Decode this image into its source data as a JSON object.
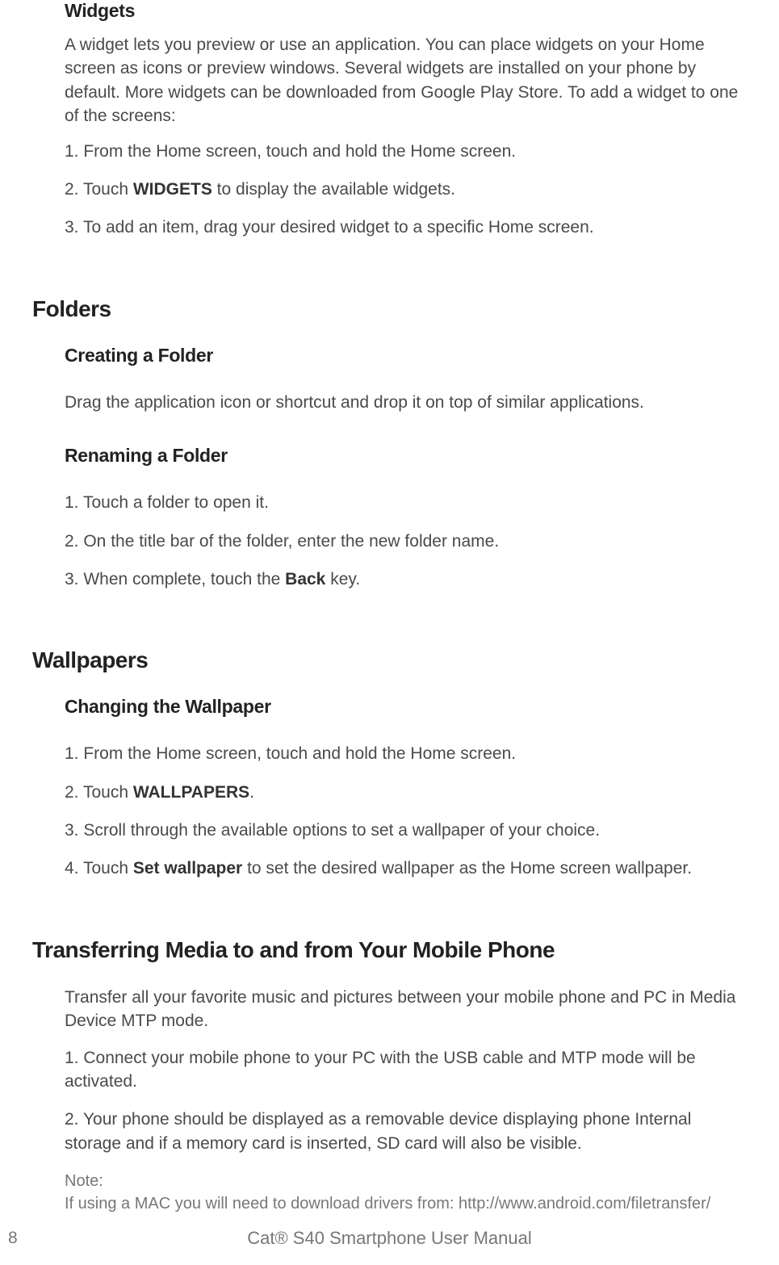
{
  "widgets": {
    "heading": "Widgets",
    "intro": "A widget lets you preview or use an application. You can place widgets on your Home screen as icons or preview windows. Several widgets are installed on your phone by default. More widgets can be downloaded from Google Play Store. To add a widget to one of the screens:",
    "step1": "1. From the Home screen, touch and hold the Home screen.",
    "step2_prefix": "2. Touch ",
    "step2_bold": "WIDGETS",
    "step2_suffix": " to display the available widgets.",
    "step3": "3. To add an item, drag your desired widget to a specific Home screen."
  },
  "folders": {
    "heading": "Folders",
    "creating": {
      "heading": "Creating a Folder",
      "text": "Drag the application icon or shortcut and drop it on top of similar applications."
    },
    "renaming": {
      "heading": "Renaming a Folder",
      "step1": "1. Touch a folder to open it.",
      "step2": "2. On the title bar of the folder, enter the new folder name.",
      "step3_prefix": "3. When complete, touch the ",
      "step3_bold": "Back",
      "step3_suffix": " key."
    }
  },
  "wallpapers": {
    "heading": "Wallpapers",
    "changing": {
      "heading": "Changing the Wallpaper",
      "step1": "1. From the Home screen, touch and hold the Home screen.",
      "step2_prefix": "2. Touch ",
      "step2_bold": "WALLPAPERS",
      "step2_suffix": ".",
      "step3": "3. Scroll through the available options to set a wallpaper of your choice.",
      "step4_prefix": "4. Touch ",
      "step4_bold": "Set wallpaper",
      "step4_suffix": " to set the desired wallpaper as the Home screen wallpaper."
    }
  },
  "transferring": {
    "heading": "Transferring Media to and from Your Mobile Phone",
    "intro": "Transfer all your favorite music and pictures between your mobile phone and PC in Media Device MTP mode.",
    "step1": "1. Connect your mobile phone to your PC with the USB cable and MTP mode will be activated.",
    "step2": "2. Your phone should be displayed as a removable device displaying phone Internal storage and if a memory card is inserted, SD card will also be visible.",
    "note_label": "Note:",
    "note_text": "If using a MAC you will need to download drivers from: http://www.android.com/filetransfer/"
  },
  "footer": {
    "page": "8",
    "title": "Cat® S40 Smartphone User Manual"
  }
}
